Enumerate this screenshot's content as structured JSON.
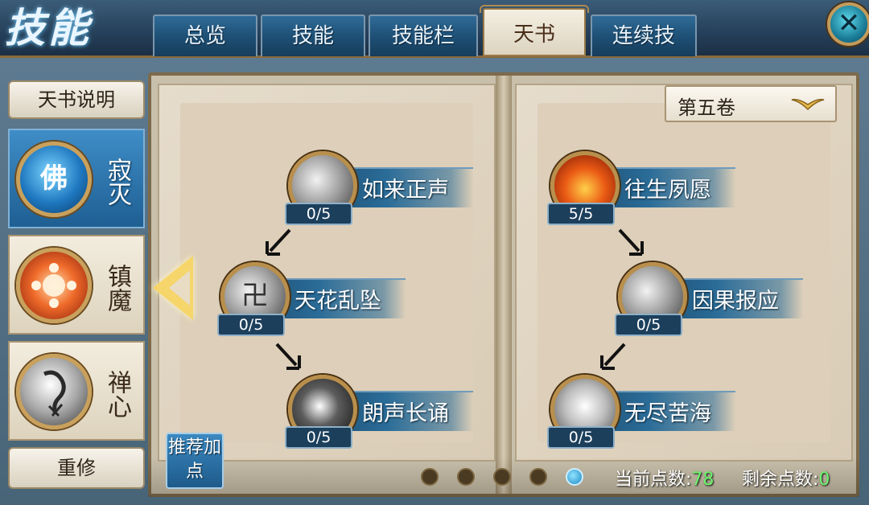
{
  "header": {
    "title": "技能",
    "tabs": [
      {
        "label": "总览",
        "active": false
      },
      {
        "label": "技能",
        "active": false
      },
      {
        "label": "技能栏",
        "active": false
      },
      {
        "label": "天书",
        "active": true
      },
      {
        "label": "连续技",
        "active": false
      }
    ],
    "close_icon": "close-x-icon"
  },
  "sidebar": {
    "info_button": "天书说明",
    "categories": [
      {
        "label": "寂灭",
        "icon_glyph": "佛",
        "active": true
      },
      {
        "label": "镇魔",
        "icon_glyph": "",
        "active": false
      },
      {
        "label": "禅心",
        "icon_glyph": "",
        "active": false
      }
    ],
    "reset_button": "重修"
  },
  "book": {
    "volume": "第五卷",
    "left_skills": [
      {
        "name": "如来正声",
        "count": "0/5"
      },
      {
        "name": "天花乱坠",
        "count": "0/5",
        "icon_glyph": "卍"
      },
      {
        "name": "朗声长诵",
        "count": "0/5"
      }
    ],
    "right_skills": [
      {
        "name": "往生夙愿",
        "count": "5/5"
      },
      {
        "name": "因果报应",
        "count": "0/5"
      },
      {
        "name": "无尽苦海",
        "count": "0/5"
      }
    ]
  },
  "footer": {
    "recommend_button": "推荐加点",
    "page_count": 5,
    "active_page": 5,
    "current_points_label": "当前点数:",
    "current_points_value": "78",
    "remaining_points_label": "剩余点数:",
    "remaining_points_value": "0"
  },
  "colors": {
    "active_tab_bg": "#ece5d4",
    "tab_bg": "#1d4e73",
    "points_value": "#6cf56c",
    "skill_bar": "#2a6c98"
  }
}
